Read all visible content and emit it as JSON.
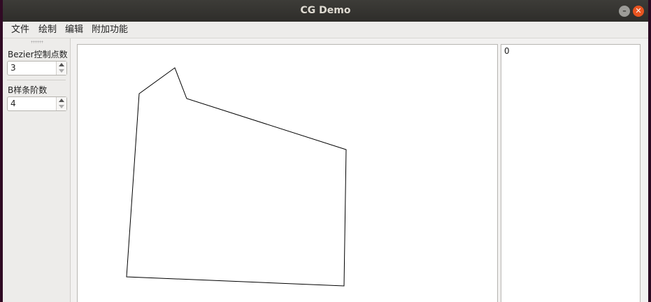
{
  "window": {
    "title": "CG Demo"
  },
  "menu": [
    "文件",
    "绘制",
    "编辑",
    "附加功能"
  ],
  "controls": {
    "bezier_label": "Bezier控制点数",
    "bezier_value": "3",
    "bspline_label": "B样条阶数",
    "bspline_value": "4"
  },
  "list": {
    "items": [
      "0"
    ]
  },
  "drawing": {
    "shape": "polygon",
    "stroke": "#000000"
  },
  "colors": {
    "close": "#e95420",
    "titlebar": "#3c3b37"
  }
}
